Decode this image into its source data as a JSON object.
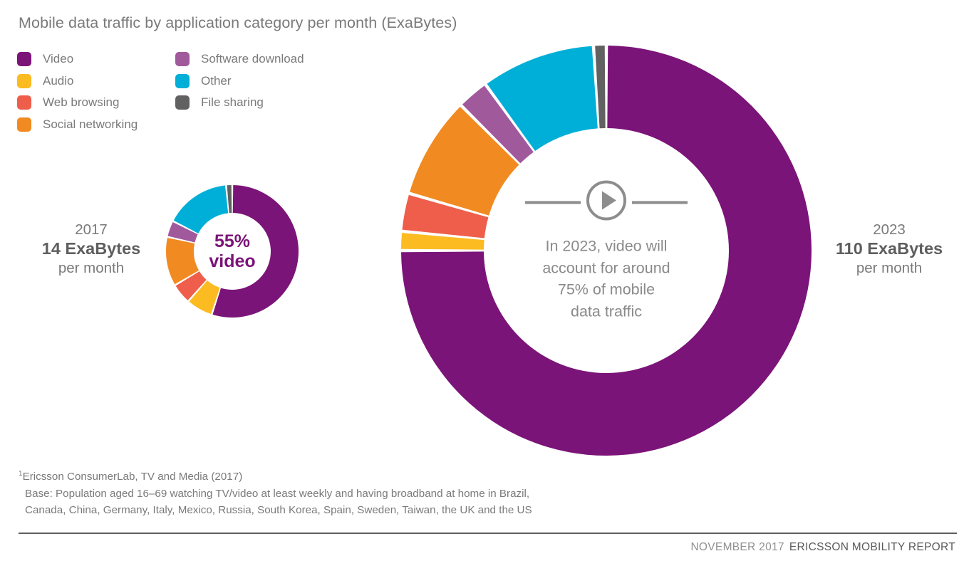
{
  "header": {
    "title": "Mobile data traffic by application category per month (ExaBytes)"
  },
  "legend": {
    "column_a": [
      {
        "label": "Video",
        "color": "#7B1478",
        "icon": "legend-swatch-video"
      },
      {
        "label": "Audio",
        "color": "#FBBB21",
        "icon": "legend-swatch-audio"
      },
      {
        "label": "Web browsing",
        "color": "#EE5E4B",
        "icon": "legend-swatch-web-browsing"
      },
      {
        "label": "Social networking",
        "color": "#F18A21",
        "icon": "legend-swatch-social-networking"
      }
    ],
    "column_b": [
      {
        "label": "Software download",
        "color": "#A0599B",
        "icon": "legend-swatch-software-download"
      },
      {
        "label": "Other",
        "color": "#00AFD7",
        "icon": "legend-swatch-other"
      },
      {
        "label": "File sharing",
        "color": "#616161",
        "icon": "legend-swatch-file-sharing"
      }
    ]
  },
  "donut_2017": {
    "year": "2017",
    "amount": "14 ExaBytes",
    "per_month": "per month",
    "center_line1": "55%",
    "center_line2": "video"
  },
  "donut_2023": {
    "year": "2023",
    "amount": "110 ExaBytes",
    "per_month": "per month",
    "center_text": "In 2023, video will account for around 75% of mobile data traffic",
    "center_lines": [
      "In 2023, video will",
      "account for around",
      "75% of mobile",
      "data traffic"
    ],
    "play_icon": "play-circle-icon"
  },
  "footnote": {
    "marker": "1",
    "line1": "Ericsson ConsumerLab, TV and Media (2017)",
    "line2": "Base: Population aged 16–69 watching TV/video at least weekly and having broadband at home in Brazil,",
    "line3": "Canada, China, Germany, Italy, Mexico, Russia, South Korea, Spain, Sweden, Taiwan, the UK and the US"
  },
  "footer": {
    "date": "NOVEMBER 2017",
    "report": "ERICSSON MOBILITY REPORT"
  },
  "chart_data": [
    {
      "type": "pie",
      "title": "Mobile data traffic by application category per month (ExaBytes)",
      "subtitle": "2017 — 14 ExaBytes per month",
      "variant": "donut",
      "total_label": "14 ExaBytes",
      "total_value": 14,
      "units": "ExaBytes per month",
      "center_label": "55% video",
      "legend_position": "top-left",
      "categories": [
        "Video",
        "File sharing",
        "Other",
        "Software download",
        "Social networking",
        "Web browsing",
        "Audio"
      ],
      "values": [
        55,
        1.5,
        16,
        4,
        12,
        5,
        6.5
      ],
      "colors": [
        "#7B1478",
        "#616161",
        "#00AFD7",
        "#A0599B",
        "#F18A21",
        "#EE5E4B",
        "#FBBB21"
      ],
      "value_units": "percent",
      "start_angle_deg": 0,
      "direction": "clockwise-from-top-for-video-then-counterclockwise-sequence"
    },
    {
      "type": "pie",
      "title": "Mobile data traffic by application category per month (ExaBytes)",
      "subtitle": "2023 — 110 ExaBytes per month",
      "variant": "donut",
      "total_label": "110 ExaBytes",
      "total_value": 110,
      "units": "ExaBytes per month",
      "center_label": "In 2023, video will account for around 75% of mobile data traffic",
      "legend_position": "top-left",
      "categories": [
        "Video",
        "File sharing",
        "Other",
        "Software download",
        "Social networking",
        "Web browsing",
        "Audio"
      ],
      "values": [
        75,
        1,
        9,
        2.5,
        8,
        3,
        1.5
      ],
      "colors": [
        "#7B1478",
        "#616161",
        "#00AFD7",
        "#A0599B",
        "#F18A21",
        "#EE5E4B",
        "#FBBB21"
      ],
      "value_units": "percent",
      "start_angle_deg": 0,
      "direction": "clockwise-from-top-for-video-then-counterclockwise-sequence"
    }
  ]
}
